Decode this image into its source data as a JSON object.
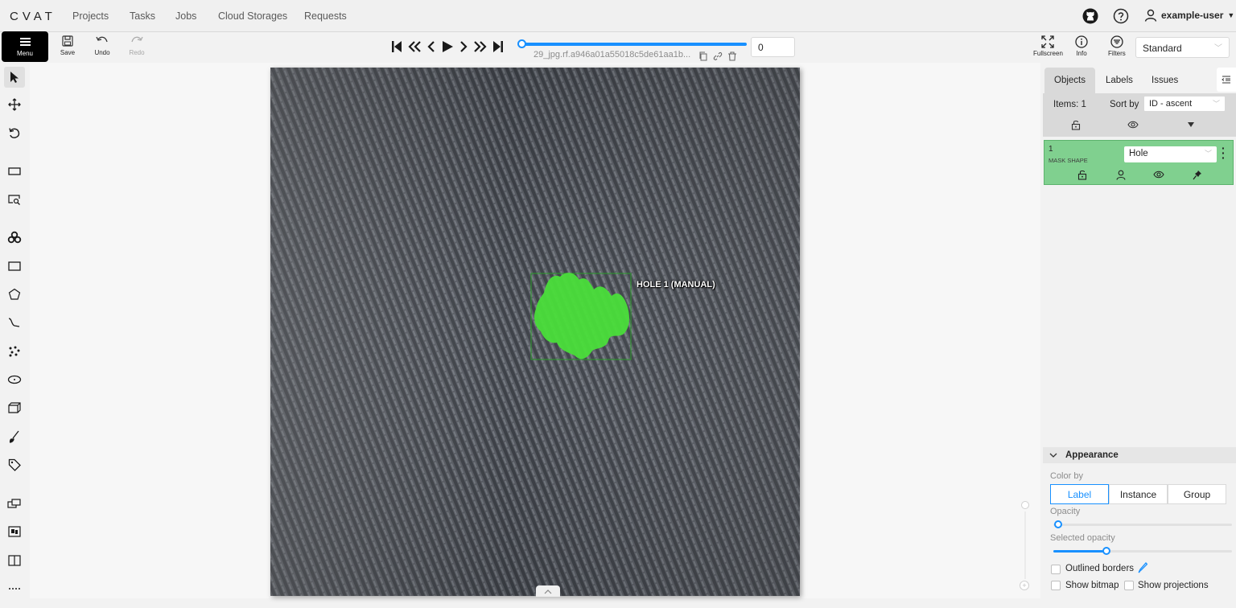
{
  "nav": {
    "logo": "CVAT",
    "links": [
      "Projects",
      "Tasks",
      "Jobs",
      "Cloud Storages",
      "Requests"
    ],
    "user": "example-user",
    "icons": [
      "github-icon",
      "help-icon",
      "user-icon"
    ]
  },
  "toolbar": {
    "menu_label": "Menu",
    "save_label": "Save",
    "undo_label": "Undo",
    "redo_label": "Redo",
    "filename": "29_jpg.rf.a946a01a55018c5de61aa1b...",
    "frame_number": "0",
    "fullscreen_label": "Fullscreen",
    "info_label": "Info",
    "filters_label": "Filters",
    "workspace": "Standard",
    "frame_progress": 0
  },
  "canvas": {
    "object_label": "HOLE 1 (MANUAL)",
    "mask_color": "#4ade3a"
  },
  "sidebar": {
    "tabs": [
      "Objects",
      "Labels",
      "Issues"
    ],
    "items_count": "Items: 1",
    "sort_label": "Sort by",
    "sort_value": "ID - ascent",
    "object": {
      "id": "1",
      "type": "MASK SHAPE",
      "label": "Hole",
      "color": "#80d08f"
    },
    "appearance": {
      "title": "Appearance",
      "color_by_label": "Color by",
      "color_by_options": [
        "Label",
        "Instance",
        "Group"
      ],
      "color_by_selected": "Label",
      "opacity_label": "Opacity",
      "opacity_value": 0,
      "selected_opacity_label": "Selected opacity",
      "selected_opacity_value": 0.3,
      "outlined_borders": "Outlined borders",
      "show_bitmap": "Show bitmap",
      "show_projections": "Show projections"
    }
  }
}
